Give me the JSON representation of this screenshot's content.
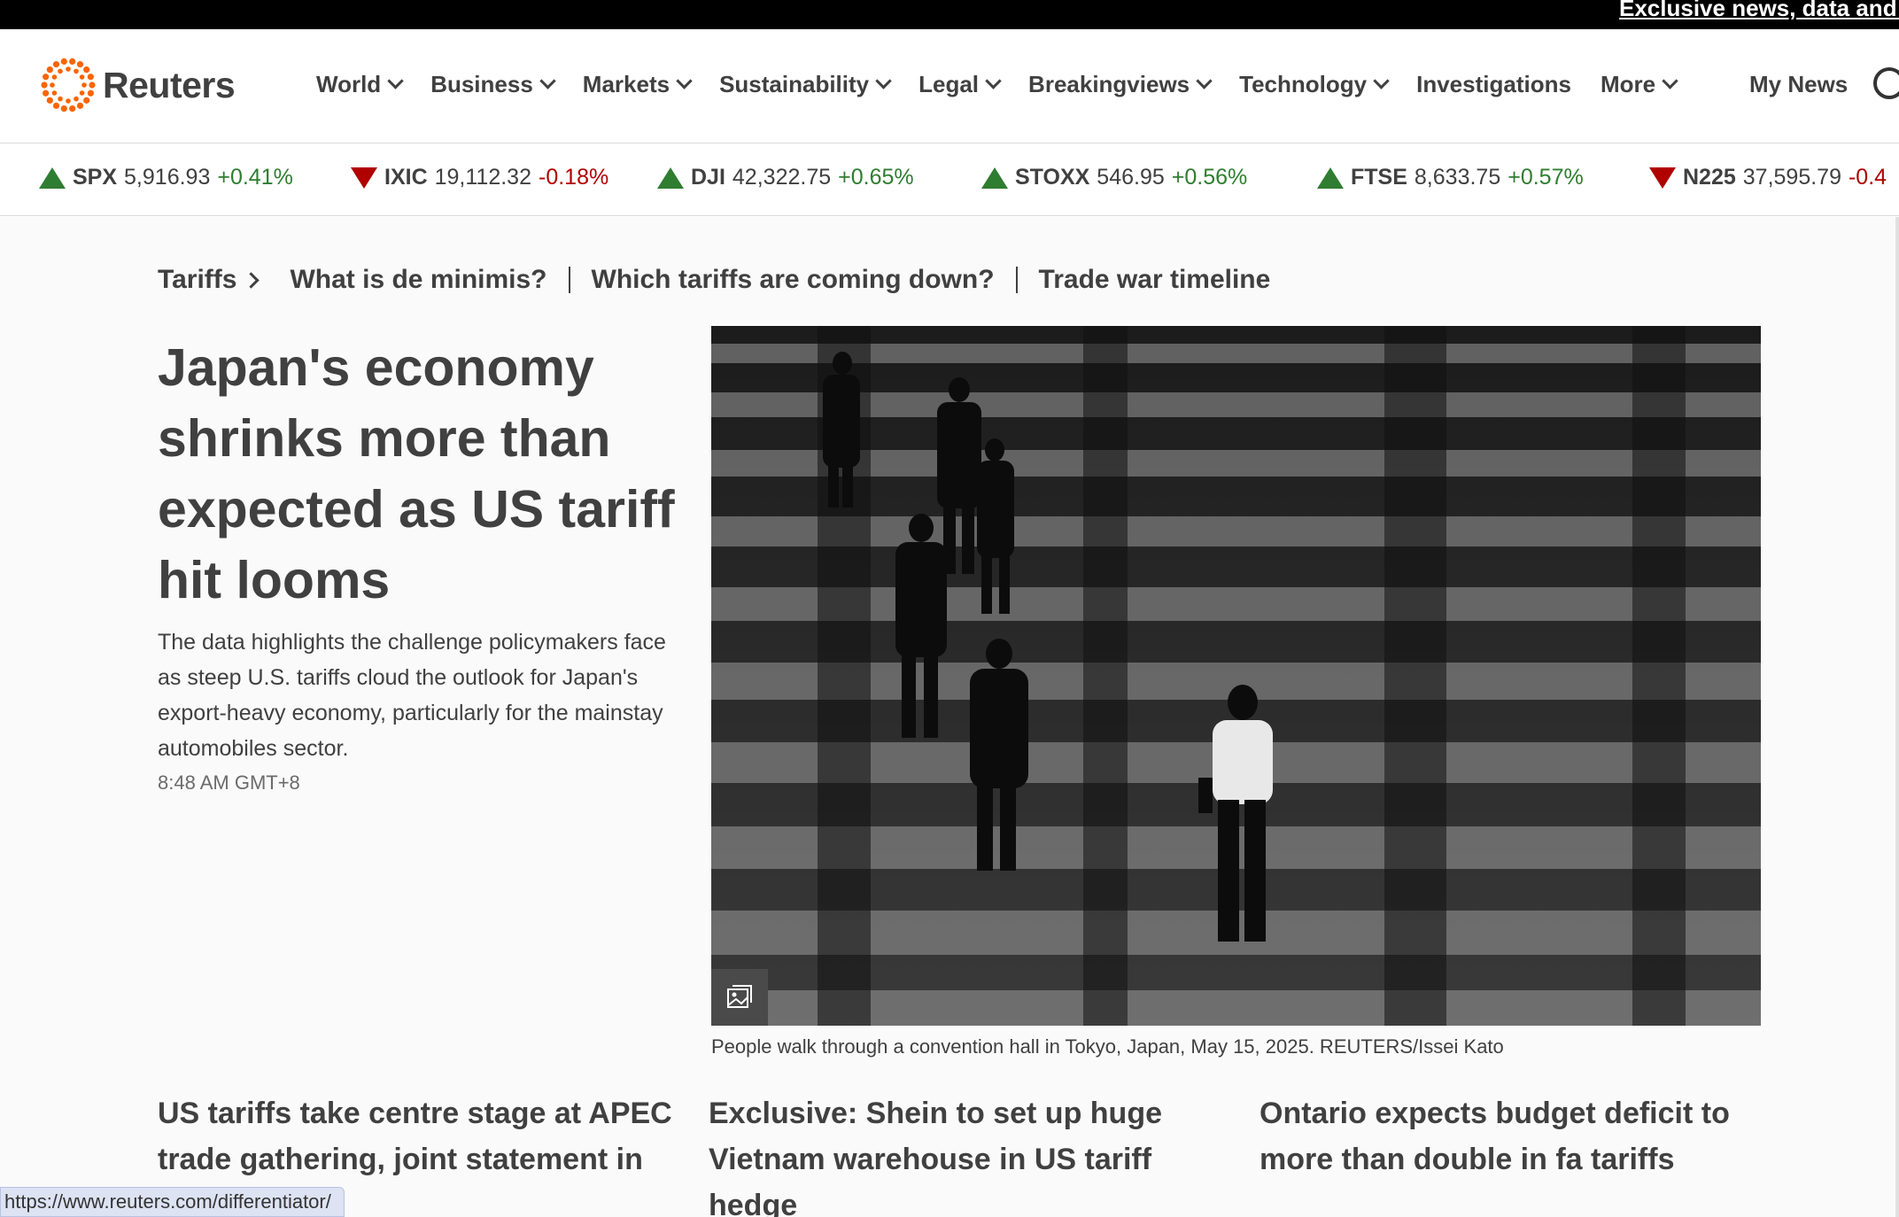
{
  "banner": {
    "text": "Exclusive news, data and analytics"
  },
  "brand": {
    "name": "Reuters",
    "color": "#fa6400"
  },
  "nav": {
    "items": [
      {
        "label": "World",
        "dropdown": true
      },
      {
        "label": "Business",
        "dropdown": true
      },
      {
        "label": "Markets",
        "dropdown": true
      },
      {
        "label": "Sustainability",
        "dropdown": true
      },
      {
        "label": "Legal",
        "dropdown": true
      },
      {
        "label": "Breakingviews",
        "dropdown": true
      },
      {
        "label": "Technology",
        "dropdown": true
      },
      {
        "label": "Investigations",
        "dropdown": false
      },
      {
        "label": "More",
        "dropdown": true
      }
    ],
    "my_news": "My News",
    "search_icon": "search-icon"
  },
  "ticker": [
    {
      "symbol": "SPX",
      "value": "5,916.93",
      "change": "+0.41%",
      "direction": "up"
    },
    {
      "symbol": "IXIC",
      "value": "19,112.32",
      "change": "-0.18%",
      "direction": "down"
    },
    {
      "symbol": "DJI",
      "value": "42,322.75",
      "change": "+0.65%",
      "direction": "up"
    },
    {
      "symbol": "STOXX",
      "value": "546.95",
      "change": "+0.56%",
      "direction": "up"
    },
    {
      "symbol": "FTSE",
      "value": "8,633.75",
      "change": "+0.57%",
      "direction": "up"
    },
    {
      "symbol": "N225",
      "value": "37,595.79",
      "change": "-0.4",
      "direction": "down"
    }
  ],
  "colors": {
    "up": "#2f7d31",
    "down": "#b00000"
  },
  "topics": {
    "main": "Tariffs",
    "links": [
      "What is de minimis?",
      "Which tariffs are coming down?",
      "Trade war timeline"
    ]
  },
  "lead": {
    "headline": "Japan's economy shrinks more than expected as US tariff hit looms",
    "summary": "The data highlights the challenge policymakers face as steep U.S. tariffs cloud the outlook for Japan's export-heavy economy, particularly for the mainstay automobiles sector.",
    "timestamp": "8:48 AM GMT+8",
    "photo_caption": "People walk through a convention hall in Tokyo, Japan, May 15, 2025. REUTERS/Issei Kato",
    "gallery_icon": "gallery-icon"
  },
  "stories": [
    {
      "headline": "US tariffs take centre stage at APEC trade gathering, joint statement in"
    },
    {
      "headline": "Exclusive: Shein to set up huge Vietnam warehouse in US tariff hedge"
    },
    {
      "headline": "Ontario expects budget deficit to more than double in fa tariffs"
    }
  ],
  "status_bar": {
    "url": "https://www.reuters.com/differentiator/"
  }
}
